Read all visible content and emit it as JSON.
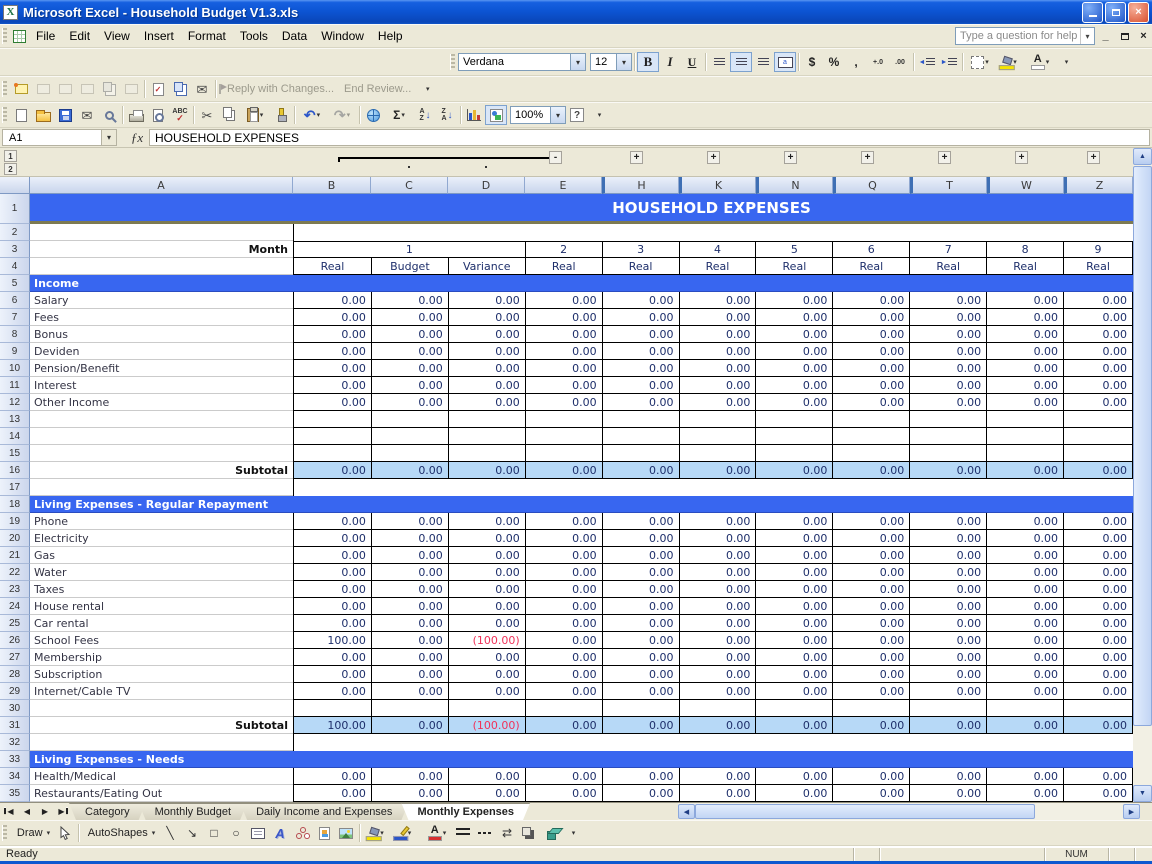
{
  "window": {
    "title": "Microsoft Excel - Household Budget V1.3.xls"
  },
  "menu": {
    "items": [
      "File",
      "Edit",
      "View",
      "Insert",
      "Format",
      "Tools",
      "Data",
      "Window",
      "Help"
    ]
  },
  "help_box": {
    "placeholder": "Type a question for help"
  },
  "glyphs": {
    "xl": "X",
    "dropdown": "▾",
    "fx": "ƒx",
    "mail": "✉",
    "cut": "✂",
    "undo": "↶",
    "redo": "↷",
    "sum": "Σ",
    "spell_abc": "ABC",
    "check": "✓",
    "a": "A",
    "z": "Z",
    "down_arrow": "↓",
    "help": "?",
    "close": "×",
    "arrow_left": "◄",
    "arrow_right": "►",
    "line": "╲",
    "diag_arrow": "↘",
    "rect": "□",
    "oval": "○",
    "swap_arrows": "⇄",
    "scroll_up": "▲",
    "scroll_down": "▼",
    "scroll_left": "◀",
    "scroll_right": "▶",
    "wordart_a": "A",
    "fontcolor_a": "A",
    "minus": "-",
    "plus": "+"
  },
  "formatting": {
    "font_name": "Verdana",
    "font_size": "12",
    "bold": "B",
    "italic": "I",
    "underline": "U",
    "currency": "$",
    "percent": "%",
    "comma": ",",
    "inc_decimal": "+.0",
    "dec_decimal": ".00"
  },
  "reviewing": {
    "reply_with_changes": "Reply with Changes...",
    "end_review": "End Review..."
  },
  "standard": {
    "zoom_value": "100%"
  },
  "formula_bar": {
    "name_box": "A1",
    "content": "HOUSEHOLD EXPENSES"
  },
  "outline": {
    "level1": "1",
    "level2": "2"
  },
  "sheet": {
    "columns": [
      "A",
      "B",
      "C",
      "D",
      "E",
      "H",
      "K",
      "N",
      "Q",
      "T",
      "W",
      "Z"
    ],
    "rows": [
      {
        "n": "1",
        "t": "title",
        "label": "HOUSEHOLD EXPENSES"
      },
      {
        "n": "2",
        "t": "spacer"
      },
      {
        "n": "3",
        "t": "months",
        "label": "Month",
        "merged": "1",
        "cells": [
          "2",
          "3",
          "4",
          "5",
          "6",
          "7",
          "8",
          "9"
        ]
      },
      {
        "n": "4",
        "t": "headers",
        "label": "",
        "cells": [
          "Real",
          "Budget",
          "Variance",
          "Real",
          "Real",
          "Real",
          "Real",
          "Real",
          "Real",
          "Real",
          "Real"
        ]
      },
      {
        "n": "5",
        "t": "section",
        "label": "Income"
      },
      {
        "n": "6",
        "t": "data",
        "label": "Salary",
        "cells": [
          "0.00",
          "0.00",
          "0.00",
          "0.00",
          "0.00",
          "0.00",
          "0.00",
          "0.00",
          "0.00",
          "0.00",
          "0.00"
        ]
      },
      {
        "n": "7",
        "t": "data",
        "label": "Fees",
        "cells": [
          "0.00",
          "0.00",
          "0.00",
          "0.00",
          "0.00",
          "0.00",
          "0.00",
          "0.00",
          "0.00",
          "0.00",
          "0.00"
        ]
      },
      {
        "n": "8",
        "t": "data",
        "label": "Bonus",
        "cells": [
          "0.00",
          "0.00",
          "0.00",
          "0.00",
          "0.00",
          "0.00",
          "0.00",
          "0.00",
          "0.00",
          "0.00",
          "0.00"
        ]
      },
      {
        "n": "9",
        "t": "data",
        "label": "Deviden",
        "cells": [
          "0.00",
          "0.00",
          "0.00",
          "0.00",
          "0.00",
          "0.00",
          "0.00",
          "0.00",
          "0.00",
          "0.00",
          "0.00"
        ]
      },
      {
        "n": "10",
        "t": "data",
        "label": "Pension/Benefit",
        "cells": [
          "0.00",
          "0.00",
          "0.00",
          "0.00",
          "0.00",
          "0.00",
          "0.00",
          "0.00",
          "0.00",
          "0.00",
          "0.00"
        ]
      },
      {
        "n": "11",
        "t": "data",
        "label": "Interest",
        "cells": [
          "0.00",
          "0.00",
          "0.00",
          "0.00",
          "0.00",
          "0.00",
          "0.00",
          "0.00",
          "0.00",
          "0.00",
          "0.00"
        ]
      },
      {
        "n": "12",
        "t": "data",
        "label": "Other Income",
        "cells": [
          "0.00",
          "0.00",
          "0.00",
          "0.00",
          "0.00",
          "0.00",
          "0.00",
          "0.00",
          "0.00",
          "0.00",
          "0.00"
        ]
      },
      {
        "n": "13",
        "t": "data",
        "label": "",
        "cells": [
          "",
          "",
          "",
          "",
          "",
          "",
          "",
          "",
          "",
          "",
          ""
        ]
      },
      {
        "n": "14",
        "t": "data",
        "label": "",
        "cells": [
          "",
          "",
          "",
          "",
          "",
          "",
          "",
          "",
          "",
          "",
          ""
        ]
      },
      {
        "n": "15",
        "t": "data",
        "label": "",
        "cells": [
          "",
          "",
          "",
          "",
          "",
          "",
          "",
          "",
          "",
          "",
          ""
        ]
      },
      {
        "n": "16",
        "t": "subtotal",
        "label": "Subtotal",
        "cells": [
          "0.00",
          "0.00",
          "0.00",
          "0.00",
          "0.00",
          "0.00",
          "0.00",
          "0.00",
          "0.00",
          "0.00",
          "0.00"
        ]
      },
      {
        "n": "17",
        "t": "spacer"
      },
      {
        "n": "18",
        "t": "section",
        "label": "Living Expenses - Regular Repayment"
      },
      {
        "n": "19",
        "t": "data",
        "label": "Phone",
        "cells": [
          "0.00",
          "0.00",
          "0.00",
          "0.00",
          "0.00",
          "0.00",
          "0.00",
          "0.00",
          "0.00",
          "0.00",
          "0.00"
        ]
      },
      {
        "n": "20",
        "t": "data",
        "label": "Electricity",
        "cells": [
          "0.00",
          "0.00",
          "0.00",
          "0.00",
          "0.00",
          "0.00",
          "0.00",
          "0.00",
          "0.00",
          "0.00",
          "0.00"
        ]
      },
      {
        "n": "21",
        "t": "data",
        "label": "Gas",
        "cells": [
          "0.00",
          "0.00",
          "0.00",
          "0.00",
          "0.00",
          "0.00",
          "0.00",
          "0.00",
          "0.00",
          "0.00",
          "0.00"
        ]
      },
      {
        "n": "22",
        "t": "data",
        "label": "Water",
        "cells": [
          "0.00",
          "0.00",
          "0.00",
          "0.00",
          "0.00",
          "0.00",
          "0.00",
          "0.00",
          "0.00",
          "0.00",
          "0.00"
        ]
      },
      {
        "n": "23",
        "t": "data",
        "label": "Taxes",
        "cells": [
          "0.00",
          "0.00",
          "0.00",
          "0.00",
          "0.00",
          "0.00",
          "0.00",
          "0.00",
          "0.00",
          "0.00",
          "0.00"
        ]
      },
      {
        "n": "24",
        "t": "data",
        "label": "House rental",
        "cells": [
          "0.00",
          "0.00",
          "0.00",
          "0.00",
          "0.00",
          "0.00",
          "0.00",
          "0.00",
          "0.00",
          "0.00",
          "0.00"
        ]
      },
      {
        "n": "25",
        "t": "data",
        "label": "Car rental",
        "cells": [
          "0.00",
          "0.00",
          "0.00",
          "0.00",
          "0.00",
          "0.00",
          "0.00",
          "0.00",
          "0.00",
          "0.00",
          "0.00"
        ]
      },
      {
        "n": "26",
        "t": "data",
        "label": "School Fees",
        "cells": [
          "100.00",
          "0.00",
          "(100.00)",
          "0.00",
          "0.00",
          "0.00",
          "0.00",
          "0.00",
          "0.00",
          "0.00",
          "0.00"
        ]
      },
      {
        "n": "27",
        "t": "data",
        "label": "Membership",
        "cells": [
          "0.00",
          "0.00",
          "0.00",
          "0.00",
          "0.00",
          "0.00",
          "0.00",
          "0.00",
          "0.00",
          "0.00",
          "0.00"
        ]
      },
      {
        "n": "28",
        "t": "data",
        "label": "Subscription",
        "cells": [
          "0.00",
          "0.00",
          "0.00",
          "0.00",
          "0.00",
          "0.00",
          "0.00",
          "0.00",
          "0.00",
          "0.00",
          "0.00"
        ]
      },
      {
        "n": "29",
        "t": "data",
        "label": "Internet/Cable TV",
        "cells": [
          "0.00",
          "0.00",
          "0.00",
          "0.00",
          "0.00",
          "0.00",
          "0.00",
          "0.00",
          "0.00",
          "0.00",
          "0.00"
        ]
      },
      {
        "n": "30",
        "t": "data",
        "label": "",
        "cells": [
          "",
          "",
          "",
          "",
          "",
          "",
          "",
          "",
          "",
          "",
          ""
        ]
      },
      {
        "n": "31",
        "t": "subtotal",
        "label": "Subtotal",
        "cells": [
          "100.00",
          "0.00",
          "(100.00)",
          "0.00",
          "0.00",
          "0.00",
          "0.00",
          "0.00",
          "0.00",
          "0.00",
          "0.00"
        ]
      },
      {
        "n": "32",
        "t": "spacer"
      },
      {
        "n": "33",
        "t": "section",
        "label": "Living Expenses - Needs"
      },
      {
        "n": "34",
        "t": "data",
        "label": "Health/Medical",
        "cells": [
          "0.00",
          "0.00",
          "0.00",
          "0.00",
          "0.00",
          "0.00",
          "0.00",
          "0.00",
          "0.00",
          "0.00",
          "0.00"
        ]
      },
      {
        "n": "35",
        "t": "data",
        "label": "Restaurants/Eating Out",
        "cells": [
          "0.00",
          "0.00",
          "0.00",
          "0.00",
          "0.00",
          "0.00",
          "0.00",
          "0.00",
          "0.00",
          "0.00",
          "0.00"
        ]
      }
    ]
  },
  "tabs": {
    "items": [
      "Category",
      "Monthly Budget",
      "Daily Income and Expenses",
      "Monthly Expenses"
    ],
    "active": "Monthly Expenses"
  },
  "drawing": {
    "draw_label": "Draw",
    "autoshapes_label": "AutoShapes"
  },
  "status": {
    "ready": "Ready",
    "num": "NUM"
  }
}
